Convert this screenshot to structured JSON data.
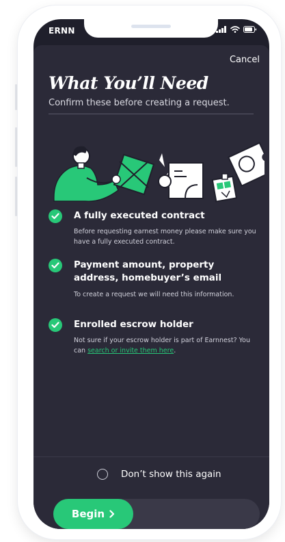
{
  "status_bar": {
    "carrier": "ERNN",
    "icons": [
      "signal-icon",
      "wifi-icon",
      "battery-icon"
    ]
  },
  "sheet": {
    "cancel_label": "Cancel",
    "title": "What You’ll Need",
    "subtitle": "Confirm these before creating a request."
  },
  "checklist": [
    {
      "title": "A fully executed contract",
      "description": "Before requesting earnest money please make sure you have a fully executed contract."
    },
    {
      "title": "Payment amount, property address, homebuyer’s email",
      "description": "To create a request we will need this information."
    },
    {
      "title": "Enrolled escrow holder",
      "description_prefix": "Not sure if your escrow holder is part of Earnnest? You can ",
      "link_text": "search or invite them here",
      "description_suffix": "."
    }
  ],
  "dont_show_label": "Don’t show this again",
  "begin_label": "Begin",
  "colors": {
    "accent": "#28c878",
    "background": "#1f1f2b",
    "sheet": "#2b2a38"
  }
}
